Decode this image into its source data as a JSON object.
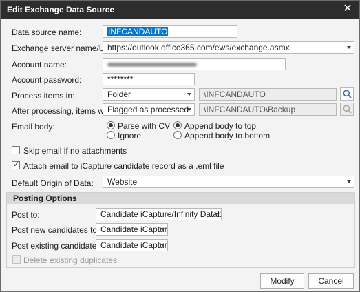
{
  "window": {
    "title": "Edit Exchange Data Source",
    "close_glyph": "✕"
  },
  "form": {
    "data_source_name": {
      "label": "Data source name:",
      "value": "INFCANDAUTO"
    },
    "server": {
      "label": "Exchange server name/URL:",
      "value": "https://outlook.office365.com/ews/exchange.asmx"
    },
    "account_name": {
      "label": "Account name:",
      "value": ""
    },
    "account_password": {
      "label": "Account password:",
      "value": "********"
    },
    "process_items": {
      "label": "Process items in:",
      "type_value": "Folder",
      "path_value": "\\INFCANDAUTO"
    },
    "after_processing": {
      "label": "After processing, items will be:",
      "type_value": "Flagged as processed",
      "path_value": "\\INFCANDAUTO\\Backup"
    },
    "email_body": {
      "label": "Email body:",
      "options": [
        {
          "label": "Parse with CV",
          "checked": true
        },
        {
          "label": "Ignore",
          "checked": false
        },
        {
          "label": "Append body to top",
          "checked": true
        },
        {
          "label": "Append body to bottom",
          "checked": false
        }
      ]
    },
    "skip_no_attachments": {
      "label": "Skip email if no attachments",
      "checked": false
    },
    "attach_email": {
      "label": "Attach email to iCapture candidate record as a .eml file",
      "checked": true
    },
    "default_origin": {
      "label": "Default Origin of Data:",
      "value": "Website"
    }
  },
  "posting": {
    "header": "Posting Options",
    "post_to": {
      "label": "Post to:",
      "value": "Candidate iCapture/Infinity Database"
    },
    "post_new": {
      "label": "Post new candidates to:",
      "value": "Candidate iCapture"
    },
    "post_existing": {
      "label": "Post existing candidates to:",
      "value": "Candidate iCapture"
    },
    "delete_duplicates": {
      "label": "Delete existing duplicates",
      "checked": false,
      "enabled": false
    }
  },
  "buttons": {
    "modify": "Modify",
    "cancel": "Cancel"
  },
  "icons": {
    "search": "search-icon",
    "close": "close-icon",
    "dropdown": "chevron-down-icon"
  },
  "colors": {
    "titlebar": "#2d2d2d",
    "selection": "#0078d7",
    "dialog_bg": "#f3f3f3"
  }
}
